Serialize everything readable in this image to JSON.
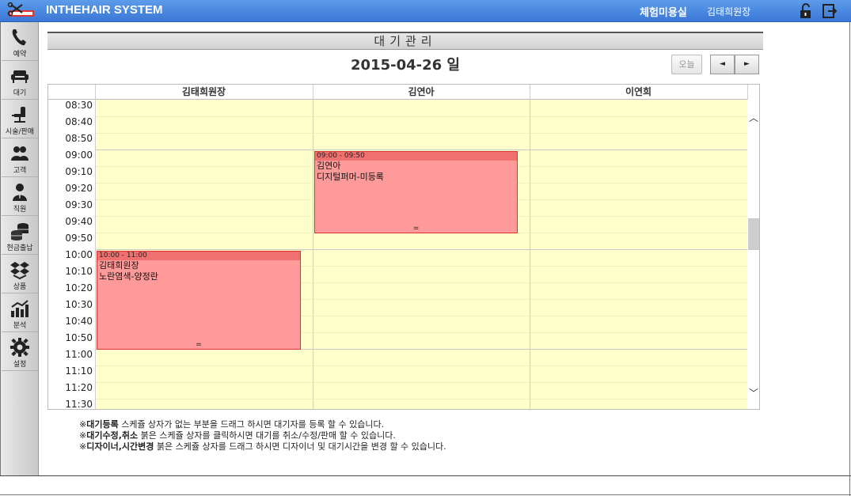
{
  "app": {
    "title": "INTHEHAIR SYSTEM",
    "shop_name": "체험미용실",
    "user_name": "김태희원장"
  },
  "sidebar": {
    "items": [
      {
        "label": "예약",
        "icon": "phone-icon"
      },
      {
        "label": "대기",
        "icon": "sofa-icon"
      },
      {
        "label": "시술/판매",
        "icon": "salon-chair-icon"
      },
      {
        "label": "고객",
        "icon": "customers-icon"
      },
      {
        "label": "직원",
        "icon": "staff-icon"
      },
      {
        "label": "현금출납",
        "icon": "coins-icon"
      },
      {
        "label": "상품",
        "icon": "boxes-icon"
      },
      {
        "label": "분석",
        "icon": "chart-icon"
      },
      {
        "label": "설정",
        "icon": "gear-icon"
      }
    ]
  },
  "page": {
    "title": "대기관리",
    "date": "2015-04-26 일",
    "today_label": "오늘",
    "prev_label": "◄",
    "next_label": "►"
  },
  "schedule": {
    "columns": [
      "김태희원장",
      "김연아",
      "이연희"
    ],
    "times": [
      "08:30",
      "08:40",
      "08:50",
      "09:00",
      "09:10",
      "09:20",
      "09:30",
      "09:40",
      "09:50",
      "10:00",
      "10:10",
      "10:20",
      "10:30",
      "10:40",
      "10:50",
      "11:00",
      "11:10",
      "11:20",
      "11:30"
    ],
    "appointments": [
      {
        "column": 1,
        "start": "09:00",
        "end": "09:50",
        "time_label": "09:00 - 09:50",
        "customer": "김연아",
        "service": "디지털퍼머-미등록",
        "handle": "="
      },
      {
        "column": 0,
        "start": "10:00",
        "end": "11:00",
        "time_label": "10:00 - 11:00",
        "customer": "김태희원장",
        "service": "노란염색-양정란",
        "handle": "="
      }
    ]
  },
  "notes": [
    {
      "mark": "※",
      "bold": "대기등록",
      "text": " 스케쥴 상자가 없는 부분을 드래그 하시면 대기자를 등록 할 수 있습니다."
    },
    {
      "mark": "※",
      "bold": "대기수정,취소",
      "text": " 붉은 스케쥴 상자를 클릭하시면 대기를 취소/수정/판매 할 수 있습니다."
    },
    {
      "mark": "※",
      "bold": "디자이너,시간변경",
      "text": " 붉은 스케쥴 상자를 드래그 하시면 디자이너 및 대기시간을 변경 할 수 있습니다."
    }
  ],
  "colors": {
    "topbar": "#3a78d6",
    "slot_bg": "#ffffcc",
    "appt_bg": "#ff9a9a",
    "appt_header": "#f07070"
  }
}
